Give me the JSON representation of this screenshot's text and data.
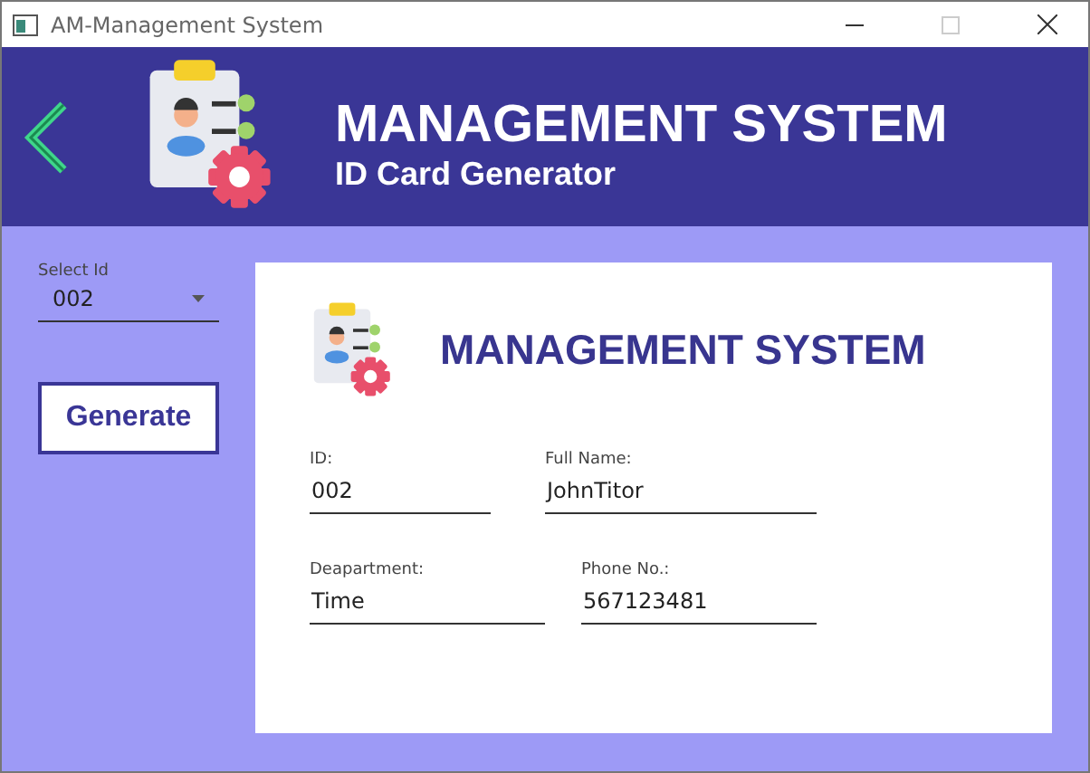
{
  "window": {
    "title": "AM-Management System"
  },
  "header": {
    "title": "MANAGEMENT SYSTEM",
    "subtitle": "ID Card Generator"
  },
  "select_id": {
    "label": "Select Id",
    "value": "002"
  },
  "generate_button": {
    "label": "Generate"
  },
  "card": {
    "title": "MANAGEMENT SYSTEM",
    "fields": [
      {
        "label": "ID:",
        "value": "002"
      },
      {
        "label": "Full Name:",
        "value": "JohnTitor"
      },
      {
        "label": "Deapartment:",
        "value": "Time"
      },
      {
        "label": "Phone No.:",
        "value": "567123481"
      }
    ]
  }
}
